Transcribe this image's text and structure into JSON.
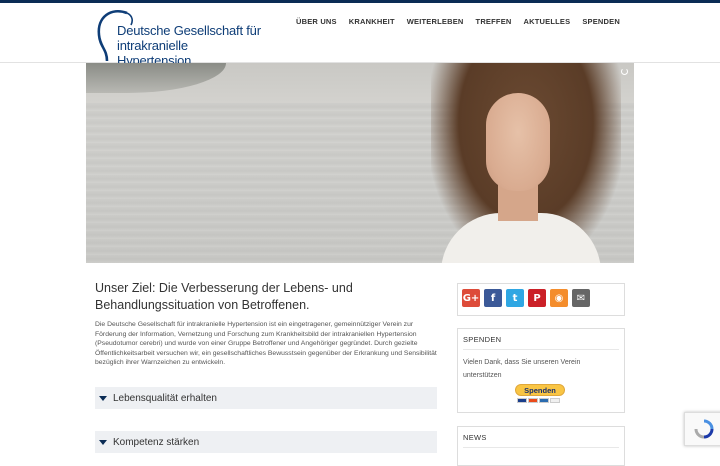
{
  "logo": {
    "line1": "Deutsche Gesellschaft für",
    "line2": "intrakranielle Hypertension"
  },
  "nav": [
    "ÜBER UNS",
    "KRANKHEIT",
    "WEITERLEBEN",
    "TREFFEN",
    "AKTUELLES",
    "SPENDEN"
  ],
  "main": {
    "heading": "Unser Ziel: Die Verbesserung der Lebens- und Behandlungssituation von Betroffenen.",
    "intro": "Die Deutsche Gesellschaft für intrakranielle Hypertension ist ein eingetragener, gemeinnütziger Verein zur Förderung der Information, Vernetzung und Forschung zum Krankheitsbild der intrakraniellen Hypertension (Pseudotumor cerebri) und wurde von einer Gruppe Betroffener und Angehöriger gegründet. Durch gezielte Öffentlichkeitsarbeit versuchen wir, ein gesellschaftliches Bewusstsein gegenüber der Erkrankung und Sensibilität bezüglich ihrer Warnzeichen zu entwickeln."
  },
  "accordion": [
    "Lebensqualität erhalten",
    "Kompetenz stärken"
  ],
  "social": [
    {
      "name": "googleplus",
      "glyph": "G+",
      "color": "#dd4b39"
    },
    {
      "name": "facebook",
      "glyph": "f",
      "color": "#3b5998"
    },
    {
      "name": "twitter",
      "glyph": "t",
      "color": "#2fa7e3"
    },
    {
      "name": "pinterest",
      "glyph": "P",
      "color": "#cb2027"
    },
    {
      "name": "rss",
      "glyph": "◉",
      "color": "#f48d2c"
    },
    {
      "name": "email",
      "glyph": "✉",
      "color": "#666666"
    }
  ],
  "sidebar": {
    "spenden_title": "SPENDEN",
    "spenden_text": "Vielen Dank, dass Sie unseren Verein unterstützen",
    "paypal_label": "Spenden",
    "news_title": "NEWS"
  },
  "colors": {
    "brand_dark": "#0b2c55",
    "logo_blue": "#0e3d77"
  }
}
